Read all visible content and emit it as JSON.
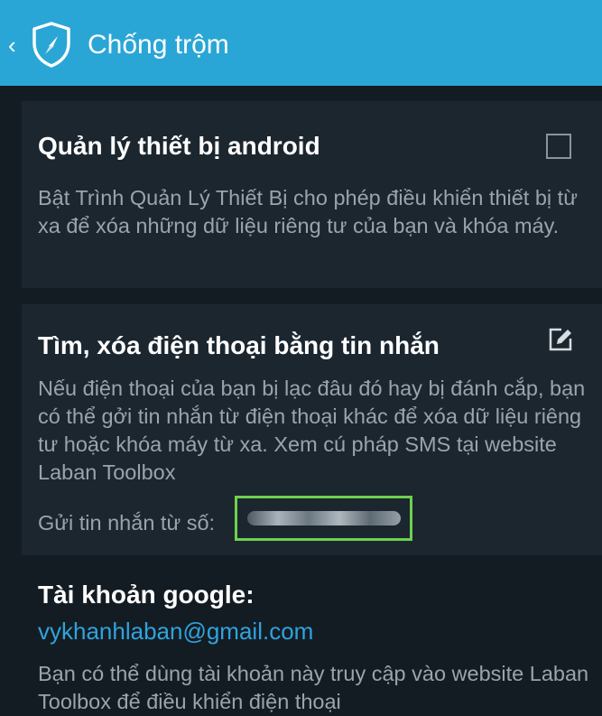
{
  "app_bar": {
    "title": "Chống trộm",
    "icon": "shield-compass-icon",
    "back_icon": "chevron-left-icon",
    "color": "#2aa6d6"
  },
  "device_admin": {
    "title": "Quản lý thiết bị android",
    "description": "Bật Trình Quản Lý Thiết Bị cho phép điều khiển thiết bị từ xa để xóa những dữ liệu riêng tư của bạn và khóa máy.",
    "checked": false
  },
  "sms_control": {
    "title": "Tìm, xóa điện thoại bằng tin nhắn",
    "description": "Nếu điện thoại của bạn bị lạc đâu đó hay bị đánh cắp, bạn có thể gởi tin nhắn từ điện thoại khác để xóa dữ liệu riêng tư hoặc khóa máy từ xa. Xem cú pháp SMS tại website Laban Toolbox",
    "sender_label": "Gửi tin nhắn từ số:",
    "edit_icon": "edit-pencil-icon",
    "highlight_color": "#6fd04d"
  },
  "google_account": {
    "title": "Tài khoản google:",
    "email": "vykhanhlaban@gmail.com",
    "description": "Bạn có thể dùng tài khoản này truy cập vào website Laban Toolbox để điều khiển điện thoại"
  }
}
